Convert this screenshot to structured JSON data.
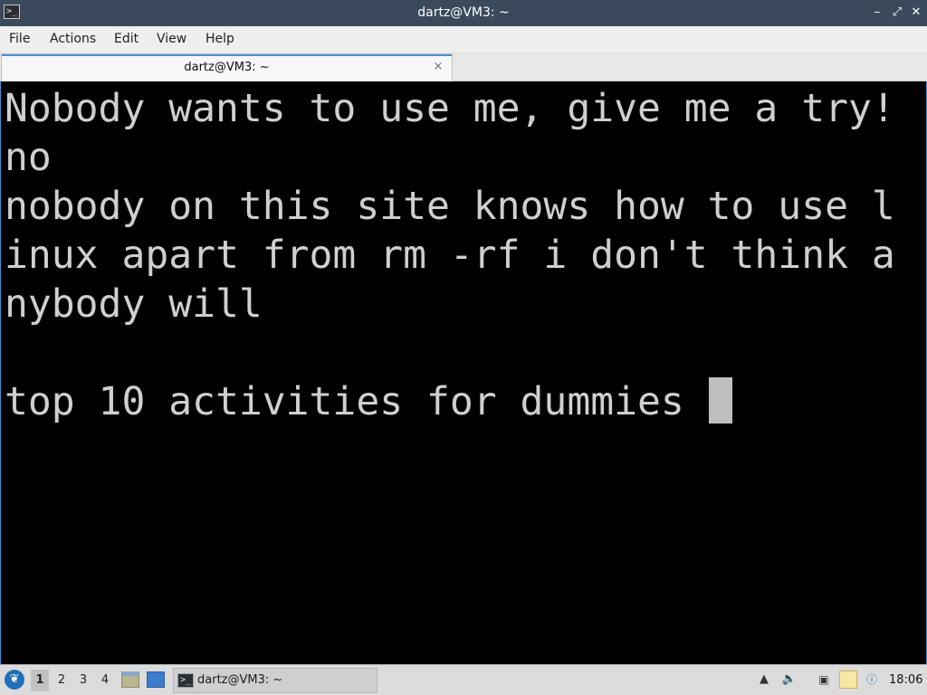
{
  "window": {
    "title": "dartz@VM3: ~",
    "controls": {
      "minimize": "–",
      "maximize": "⤢",
      "close": "✕"
    }
  },
  "menu": [
    "File",
    "Actions",
    "Edit",
    "View",
    "Help"
  ],
  "tabs": [
    {
      "label": "dartz@VM3: ~",
      "close": "×"
    }
  ],
  "terminal": {
    "lines": [
      "Nobody wants to use me, give me a try!",
      "no",
      "nobody on this site knows how to use l",
      "inux apart from rm -rf i don't think a",
      "nybody will",
      "",
      "top 10 activities for dummies "
    ],
    "colors": {
      "background": "#000000",
      "text": "#cfcfcf",
      "cursor": "#bfbfbf"
    }
  },
  "taskbar": {
    "start_icon": "lxqt-menu-icon",
    "workspaces": [
      "1",
      "2",
      "3",
      "4"
    ],
    "active_workspace": "1",
    "launchers": [
      "file-manager-icon",
      "desktop-icon"
    ],
    "task": {
      "label": "dartz@VM3: ~",
      "icon": "terminal-icon"
    },
    "tray_icons": [
      "upload-icon",
      "volume-icon",
      "network-icon",
      "clipboard-icon",
      "update-notifier-icon"
    ],
    "clock": "18:06"
  },
  "accent_color": "#4a90d9"
}
